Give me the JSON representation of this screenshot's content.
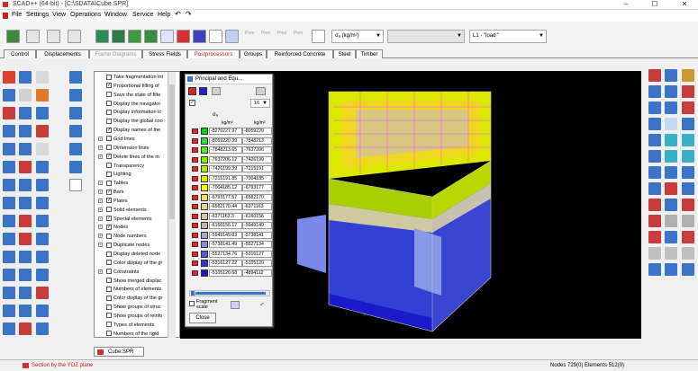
{
  "window": {
    "title": "SCAD++ (64-bit) - [C:\\SDATA\\Cube.SPR]",
    "min": "–",
    "max": "☐",
    "close": "✕"
  },
  "menu": [
    "File",
    "Settings",
    "View",
    "Operations",
    "Window",
    "Service",
    "Help",
    "↶",
    "↷"
  ],
  "toolbar": {
    "grayed_buttons": [
      "Prev",
      "Prev",
      "Prev",
      "Prev"
    ],
    "quantity": "σₐ (kg/m²)",
    "load": "L1 - \"load \""
  },
  "tabs": [
    {
      "label": "Control",
      "state": "normal"
    },
    {
      "label": "Displacements",
      "state": "normal"
    },
    {
      "label": "Frame Diagrams",
      "state": "dim"
    },
    {
      "label": "Stress Fields",
      "state": "normal"
    },
    {
      "label": "Postprocessors",
      "state": "active"
    },
    {
      "label": "Groups",
      "state": "normal"
    },
    {
      "label": "Reinforced Concrete",
      "state": "normal"
    },
    {
      "label": "Steel",
      "state": "normal"
    },
    {
      "label": "Timber",
      "state": "normal"
    }
  ],
  "tree": [
    {
      "label": "Take fragmentation int",
      "check": false,
      "toggle": ""
    },
    {
      "label": "Proportional filling of",
      "check": true,
      "toggle": ""
    },
    {
      "label": "Save the state of filte",
      "check": false,
      "toggle": ""
    },
    {
      "label": "Display the navigator",
      "check": false,
      "toggle": ""
    },
    {
      "label": "Display information ic",
      "check": false,
      "toggle": ""
    },
    {
      "label": "Display the global coo",
      "check": false,
      "toggle": ""
    },
    {
      "label": "Display names of the",
      "check": true,
      "toggle": ""
    },
    {
      "label": "Grid lines",
      "check": false,
      "toggle": "+"
    },
    {
      "label": "Dimension lines",
      "check": false,
      "toggle": "+"
    },
    {
      "label": "Delete lines of the m",
      "check": true,
      "toggle": "+"
    },
    {
      "label": "Transparency",
      "check": false,
      "toggle": ""
    },
    {
      "label": "Lighting",
      "check": false,
      "toggle": ""
    },
    {
      "label": "Tables",
      "check": false,
      "toggle": "+"
    },
    {
      "label": "Bars",
      "check": true,
      "toggle": "+"
    },
    {
      "label": "Plates",
      "check": true,
      "toggle": "+"
    },
    {
      "label": "Solid elements",
      "check": false,
      "toggle": "+"
    },
    {
      "label": "Special elements",
      "check": true,
      "toggle": "+"
    },
    {
      "label": "Nodes",
      "check": true,
      "toggle": "+"
    },
    {
      "label": "Node numbers",
      "check": false,
      "toggle": "+"
    },
    {
      "label": "Duplicate nodes",
      "check": false,
      "toggle": "+"
    },
    {
      "label": "Display deleted node",
      "check": false,
      "toggle": ""
    },
    {
      "label": "Color display of the gr",
      "check": false,
      "toggle": ""
    },
    {
      "label": "Constraints",
      "check": false,
      "toggle": "+"
    },
    {
      "label": "Show merged displac",
      "check": false,
      "toggle": ""
    },
    {
      "label": "Numbers of elements",
      "check": false,
      "toggle": ""
    },
    {
      "label": "Color display of the gr",
      "check": false,
      "toggle": ""
    },
    {
      "label": "Show groups of struc",
      "check": false,
      "toggle": ""
    },
    {
      "label": "Show groups of reinfo",
      "check": false,
      "toggle": ""
    },
    {
      "label": "Types of elements",
      "check": false,
      "toggle": ""
    },
    {
      "label": "Numbers of the rigid",
      "check": false,
      "toggle": ""
    }
  ],
  "dialog": {
    "title": "Principal and Equ...",
    "scale_count": "16",
    "quantity": "σₐ",
    "unit1": "kg/m²",
    "unit2": "kg/m²",
    "rows": [
      {
        "color": "#00d200",
        "v1": "-8270227.97",
        "v2": "-8059220"
      },
      {
        "color": "#33e033",
        "v1": "-8059220.39",
        "v2": "-7848213"
      },
      {
        "color": "#55ee22",
        "v1": "-7848213.65",
        "v2": "-7637206"
      },
      {
        "color": "#80f000",
        "v1": "-7637206.12",
        "v2": "-7426199"
      },
      {
        "color": "#aaf000",
        "v1": "-7426199.39",
        "v2": "-7215191"
      },
      {
        "color": "#d8f000",
        "v1": "-7215191.85",
        "v2": "-7004185"
      },
      {
        "color": "#ffff00",
        "v1": "-7004185.12",
        "v2": "-6793177"
      },
      {
        "color": "#f0e060",
        "v1": "-6793177.57",
        "v2": "-6582170"
      },
      {
        "color": "#e8d48c",
        "v1": "-6582170.44",
        "v2": "-6371163"
      },
      {
        "color": "#d8c8a0",
        "v1": "-6371163.3",
        "v2": "-6160156"
      },
      {
        "color": "#c0b8b0",
        "v1": "-6160156.17",
        "v2": "-5949149"
      },
      {
        "color": "#a8a8c8",
        "v1": "-5949149.03",
        "v2": "-5738141"
      },
      {
        "color": "#8888d8",
        "v1": "-5738141.49",
        "v2": "-5527134"
      },
      {
        "color": "#5555dd",
        "v1": "-5527134.76",
        "v2": "-5316127"
      },
      {
        "color": "#3333dd",
        "v1": "-5316127.22",
        "v2": "-5105120"
      },
      {
        "color": "#1818c8",
        "v1": "-5105120.68",
        "v2": "-4894112"
      }
    ],
    "fragment_label": "Fragment scale",
    "close_label": "Close"
  },
  "document_tab": "Cube.SPR",
  "status": {
    "left": "Section by the YOZ plane",
    "right": "Nodes 729(0) Elements 512(0)"
  }
}
